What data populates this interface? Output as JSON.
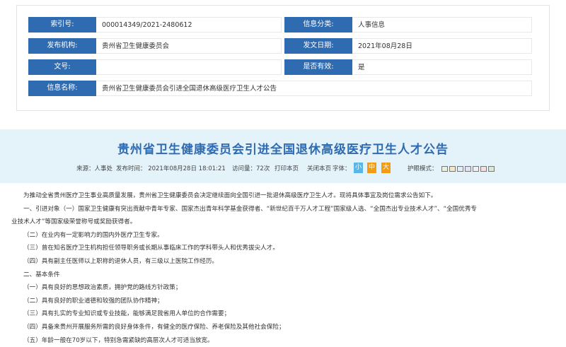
{
  "meta": {
    "index_label": "索引号:",
    "index_value": "000014349/2021-2480612",
    "category_label": "信息分类:",
    "category_value": "人事信息",
    "issuer_label": "发布机构:",
    "issuer_value": "贵州省卫生健康委员会",
    "date_label": "发文日期:",
    "date_value": "2021年08月28日",
    "docno_label": "文号:",
    "docno_value": "",
    "valid_label": "是否有效:",
    "valid_value": "是",
    "name_label": "信息名称:",
    "name_value": "贵州省卫生健康委员会引进全国退休高级医疗卫生人才公告"
  },
  "article": {
    "title": "贵州省卫生健康委员会引进全国退休高级医疗卫生人才公告",
    "source": "来源：人事处",
    "publish_time": "发布时间： 2021年08月28日 18:01:21",
    "visits": "访问量：72次",
    "print": "打印本页",
    "close": "关闭本页",
    "font_label": "字体：",
    "font_small": "小",
    "font_medium": "中",
    "font_large": "大",
    "eye_care_label": "护眼模式：",
    "paragraphs": [
      "为推动全省贵州医疗卫生事业高质量发展，贵州省卫生健康委员会决定继续面向全国引进一批退休高级医疗卫生人才。现将具体事宜及岗位需求公告如下。",
      "一、引进对象（一）国家卫生健康有突出贡献中青年专家、国家杰出青年科学基金获得者、“新世纪百千万人才工程”国家级人选、“全国杰出专业技术人才”、“全国优秀专",
      "业技术人才”等国家级荣誉称号或奖励获得者。",
      "（二）在业内有一定影响力的国内外医疗卫生专家。",
      "（三）曾在知名医疗卫生机构担任领导职务或长期从事临床工作的学科带头人和优秀拔尖人才。",
      "（四）具有副主任医师以上职称的退休人员，有三级以上医院工作经历。",
      "二、基本条件",
      "（一）具有良好的思想政治素质，拥护党的路线方针政策；",
      "（二）具有良好的职业道德和较强的团队协作精神；",
      "（三）具有扎实的专业知识或专业技能，能够满足我省用人单位的合作需要；",
      "（四）具备来贵州开展服务所需的良好身体条件，有健全的医疗保险、养老保险及其他社会保险；",
      "（五）年龄一般在70岁以下，特别急需紧缺的高层次人才可适当放宽。"
    ]
  },
  "colors": {
    "label_bg": "#2f6bb1",
    "title_color": "#2f6bb1",
    "head_bg": "#e4f2fa",
    "font_small_bg": "#5ab5e8",
    "font_medium_bg": "#f39c12",
    "font_large_bg": "#f39c12",
    "swatches": [
      "#e8f0e0",
      "#f5e6c8",
      "#e0eef5",
      "#e8e0f0",
      "#f0f0f0",
      "#f5e0e0",
      "#d8ebd0"
    ]
  }
}
